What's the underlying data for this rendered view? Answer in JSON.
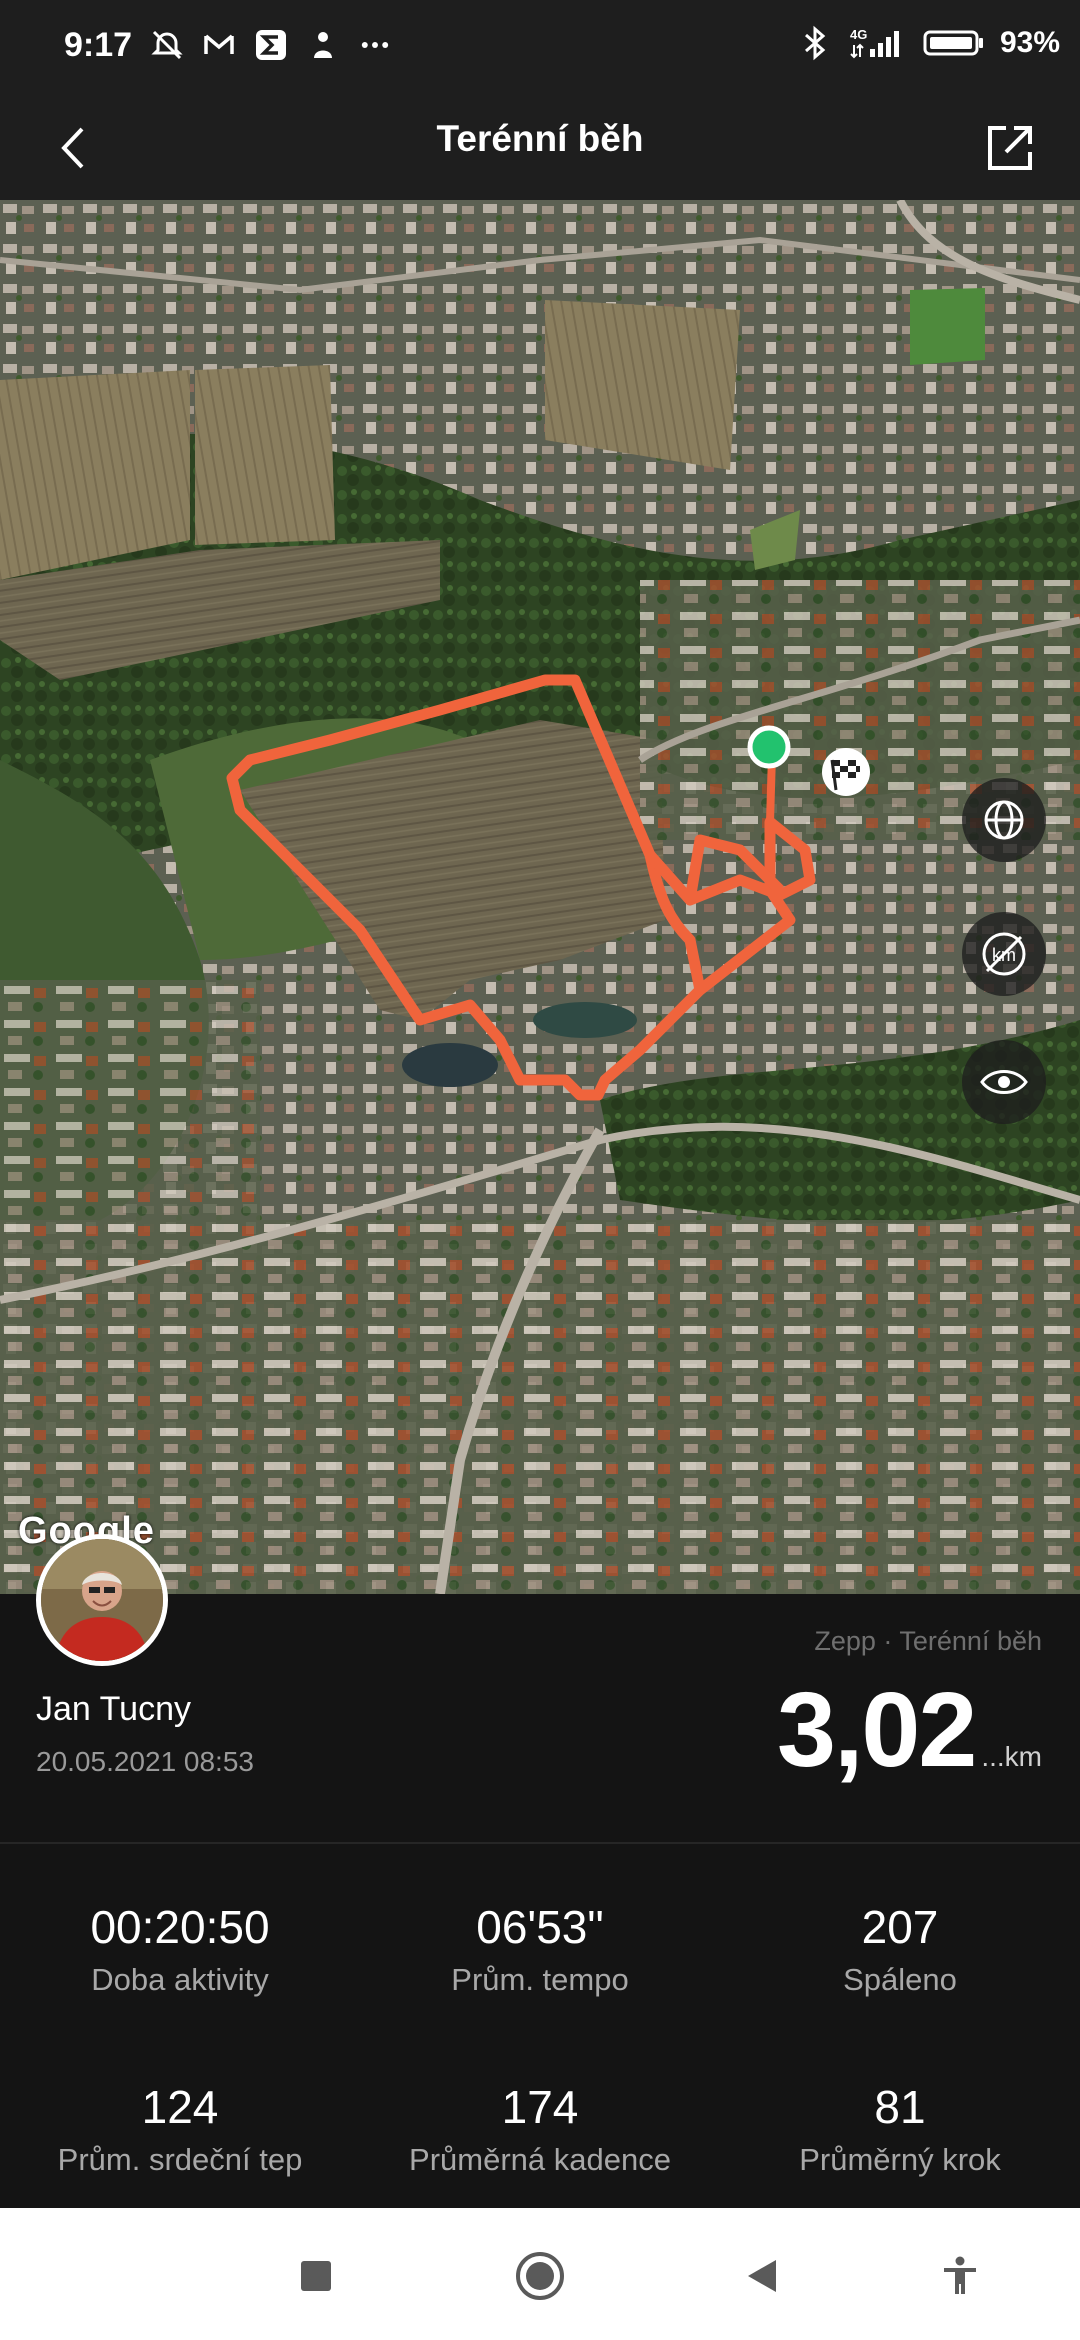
{
  "status_bar": {
    "time": "9:17",
    "icons": [
      "alarm-off-icon",
      "gmail-icon",
      "sigma-app-icon",
      "person-app-icon",
      "more-icon"
    ],
    "right_icons": [
      "bluetooth-icon",
      "signal-4g-icon",
      "battery-icon"
    ],
    "battery": "93%"
  },
  "header": {
    "title": "Terénní běh",
    "back_icon": "back-chevron-icon",
    "share_icon": "share-icon"
  },
  "map": {
    "attribution": "Google",
    "controls": [
      "globe-icon",
      "km-markers-off-icon",
      "eye-icon"
    ],
    "route_color": "#f0643c",
    "start_color": "#22c26e"
  },
  "activity": {
    "source": "Zepp · Terénní běh",
    "user_name": "Jan Tucny",
    "date": "20.05.2021 08:53",
    "distance": "3,02",
    "distance_unit": "...km"
  },
  "stats": [
    {
      "value": "00:20:50",
      "label": "Doba aktivity"
    },
    {
      "value": "06'53\"",
      "label": "Prům. tempo"
    },
    {
      "value": "207",
      "label": "Spáleno"
    },
    {
      "value": "124",
      "label": "Prům. srdeční tep"
    },
    {
      "value": "174",
      "label": "Průměrná kadence"
    },
    {
      "value": "81",
      "label": "Průměrný krok"
    }
  ],
  "nav": [
    "recents-button",
    "home-button",
    "back-button",
    "accessibility-button"
  ]
}
